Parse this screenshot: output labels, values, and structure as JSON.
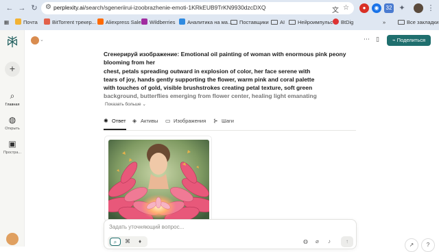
{
  "browser": {
    "url_domain": "perplexity.ai",
    "url_path": "/search/sgeneriirui-izoobrazhenie-emoti-1KRkEUB9TrKN9930dzcDXQ",
    "bookmarks": [
      {
        "label": "Почта",
        "color": "#f2b233"
      },
      {
        "label": "BitTorrent трекер...",
        "color": "#e2604a"
      },
      {
        "label": "Aliexpress Saler",
        "color": "#ff6a00"
      },
      {
        "label": "Wildberries",
        "color": "#a12ca0"
      },
      {
        "label": "Аналитика на ма...",
        "color": "#2f8ae0"
      },
      {
        "label": "Поставщики",
        "color": "folder"
      },
      {
        "label": "AI",
        "color": "folder"
      },
      {
        "label": "Нейроимпульс",
        "color": "folder"
      },
      {
        "label": "BtDig",
        "color": "#d33"
      }
    ],
    "all_bookmarks": "Все закладки",
    "ext_badge": "32"
  },
  "sidebar": {
    "items": [
      {
        "label": "Главная"
      },
      {
        "label": "Открыть"
      },
      {
        "label": "Простра..."
      }
    ]
  },
  "header": {
    "share_label": "Поделиться"
  },
  "query": {
    "lines": [
      "Сгенерируй изображение: Emotional oil painting of woman with enormous pink peony",
      "blooming from her",
      "chest, petals spreading outward in explosion of color, her face serene with",
      "tears of joy, hands gently supporting the flower, warm pink and coral palette",
      "with touches of gold, visible brushstrokes creating petal texture, soft green",
      "background, butterflies emerging from flower center, healing light emanating"
    ],
    "show_more": "Показать больше"
  },
  "tabs": [
    {
      "label": "Ответ",
      "icon": "perplexity-icon"
    },
    {
      "label": "Активы",
      "icon": "layers-icon"
    },
    {
      "label": "Изображения",
      "icon": "image-icon"
    },
    {
      "label": "Шаги",
      "icon": "steps-icon"
    }
  ],
  "composer": {
    "placeholder": "Задать уточняющий вопрос..."
  },
  "colors": {
    "accent": "#1f6f6e",
    "chrome": "#dfe7f2"
  }
}
